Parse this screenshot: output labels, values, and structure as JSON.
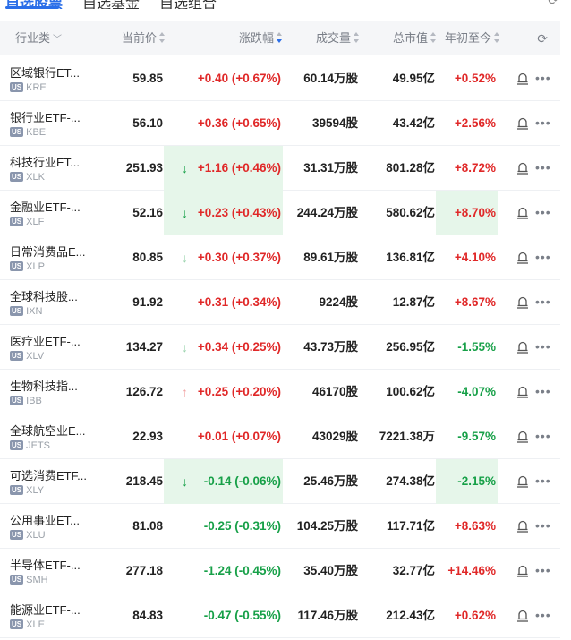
{
  "tabs": [
    "自选股票",
    "自选基金",
    "自选组合"
  ],
  "header": {
    "industry": "行业类",
    "price": "当前价",
    "change": "涨跌幅",
    "volume": "成交量",
    "market_cap": "总市值",
    "ytd": "年初至今"
  },
  "rows": [
    {
      "name": "区域银行ET...",
      "market": "US",
      "ticker": "KRE",
      "price": "59.85",
      "change": "+0.40 (+0.67%)",
      "change_color": "red",
      "arrow": "",
      "change_highlight": false,
      "volume": "60.14万股",
      "market_cap": "49.95亿",
      "ytd": "+0.52%",
      "ytd_color": "red",
      "ytd_highlight": false
    },
    {
      "name": "银行业ETF-...",
      "market": "US",
      "ticker": "KBE",
      "price": "56.10",
      "change": "+0.36 (+0.65%)",
      "change_color": "red",
      "arrow": "",
      "change_highlight": false,
      "volume": "39594股",
      "market_cap": "43.42亿",
      "ytd": "+2.56%",
      "ytd_color": "red",
      "ytd_highlight": false
    },
    {
      "name": "科技行业ET...",
      "market": "US",
      "ticker": "XLK",
      "price": "251.93",
      "change": "+1.16 (+0.46%)",
      "change_color": "red",
      "arrow": "↓",
      "arrow_class": "g",
      "change_highlight": true,
      "volume": "31.31万股",
      "market_cap": "801.28亿",
      "ytd": "+8.72%",
      "ytd_color": "red",
      "ytd_highlight": false
    },
    {
      "name": "金融业ETF-...",
      "market": "US",
      "ticker": "XLF",
      "price": "52.16",
      "change": "+0.23 (+0.43%)",
      "change_color": "red",
      "arrow": "↓",
      "arrow_class": "g",
      "change_highlight": true,
      "volume": "244.24万股",
      "market_cap": "580.62亿",
      "ytd": "+8.70%",
      "ytd_color": "red",
      "ytd_highlight": true
    },
    {
      "name": "日常消费品E...",
      "market": "US",
      "ticker": "XLP",
      "price": "80.85",
      "change": "+0.30 (+0.37%)",
      "change_color": "red",
      "arrow": "↓",
      "arrow_class": "lg",
      "change_highlight": false,
      "volume": "89.61万股",
      "market_cap": "136.81亿",
      "ytd": "+4.10%",
      "ytd_color": "red",
      "ytd_highlight": false
    },
    {
      "name": "全球科技股...",
      "market": "US",
      "ticker": "IXN",
      "price": "91.92",
      "change": "+0.31 (+0.34%)",
      "change_color": "red",
      "arrow": "",
      "change_highlight": false,
      "volume": "9224股",
      "market_cap": "12.87亿",
      "ytd": "+8.67%",
      "ytd_color": "red",
      "ytd_highlight": false
    },
    {
      "name": "医疗业ETF-...",
      "market": "US",
      "ticker": "XLV",
      "price": "134.27",
      "change": "+0.34 (+0.25%)",
      "change_color": "red",
      "arrow": "↓",
      "arrow_class": "lg",
      "change_highlight": false,
      "volume": "43.73万股",
      "market_cap": "256.95亿",
      "ytd": "-1.55%",
      "ytd_color": "green",
      "ytd_highlight": false
    },
    {
      "name": "生物科技指...",
      "market": "US",
      "ticker": "IBB",
      "price": "126.72",
      "change": "+0.25 (+0.20%)",
      "change_color": "red",
      "arrow": "↑",
      "arrow_class": "lr",
      "change_highlight": false,
      "volume": "46170股",
      "market_cap": "100.62亿",
      "ytd": "-4.07%",
      "ytd_color": "green",
      "ytd_highlight": false
    },
    {
      "name": "全球航空业E...",
      "market": "US",
      "ticker": "JETS",
      "price": "22.93",
      "change": "+0.01 (+0.07%)",
      "change_color": "red",
      "arrow": "",
      "change_highlight": false,
      "volume": "43029股",
      "market_cap": "7221.38万",
      "ytd": "-9.57%",
      "ytd_color": "green",
      "ytd_highlight": false
    },
    {
      "name": "可选消费ETF...",
      "market": "US",
      "ticker": "XLY",
      "price": "218.45",
      "change": "-0.14 (-0.06%)",
      "change_color": "green",
      "arrow": "↓",
      "arrow_class": "g",
      "change_highlight": true,
      "volume": "25.46万股",
      "market_cap": "274.38亿",
      "ytd": "-2.15%",
      "ytd_color": "green",
      "ytd_highlight": true
    },
    {
      "name": "公用事业ET...",
      "market": "US",
      "ticker": "XLU",
      "price": "81.08",
      "change": "-0.25 (-0.31%)",
      "change_color": "green",
      "arrow": "",
      "change_highlight": false,
      "volume": "104.25万股",
      "market_cap": "117.71亿",
      "ytd": "+8.63%",
      "ytd_color": "red",
      "ytd_highlight": false
    },
    {
      "name": "半导体ETF-...",
      "market": "US",
      "ticker": "SMH",
      "price": "277.18",
      "change": "-1.24 (-0.45%)",
      "change_color": "green",
      "arrow": "",
      "change_highlight": false,
      "volume": "35.40万股",
      "market_cap": "32.77亿",
      "ytd": "+14.46%",
      "ytd_color": "red",
      "ytd_highlight": false
    },
    {
      "name": "能源业ETF-...",
      "market": "US",
      "ticker": "XLE",
      "price": "84.83",
      "change": "-0.47 (-0.55%)",
      "change_color": "green",
      "arrow": "",
      "change_highlight": false,
      "volume": "117.46万股",
      "market_cap": "212.43亿",
      "ytd": "+0.62%",
      "ytd_color": "red",
      "ytd_highlight": false
    }
  ],
  "colors": {
    "accent": "#2a6ee8",
    "up": "#e02828",
    "down": "#17a048",
    "highlight": "#e6f6ea"
  },
  "icons": {
    "refresh": "refresh-icon",
    "bell": "bell-icon",
    "more": "more-icon",
    "sort": "sort-icon",
    "dropdown": "chevron-down-icon"
  }
}
